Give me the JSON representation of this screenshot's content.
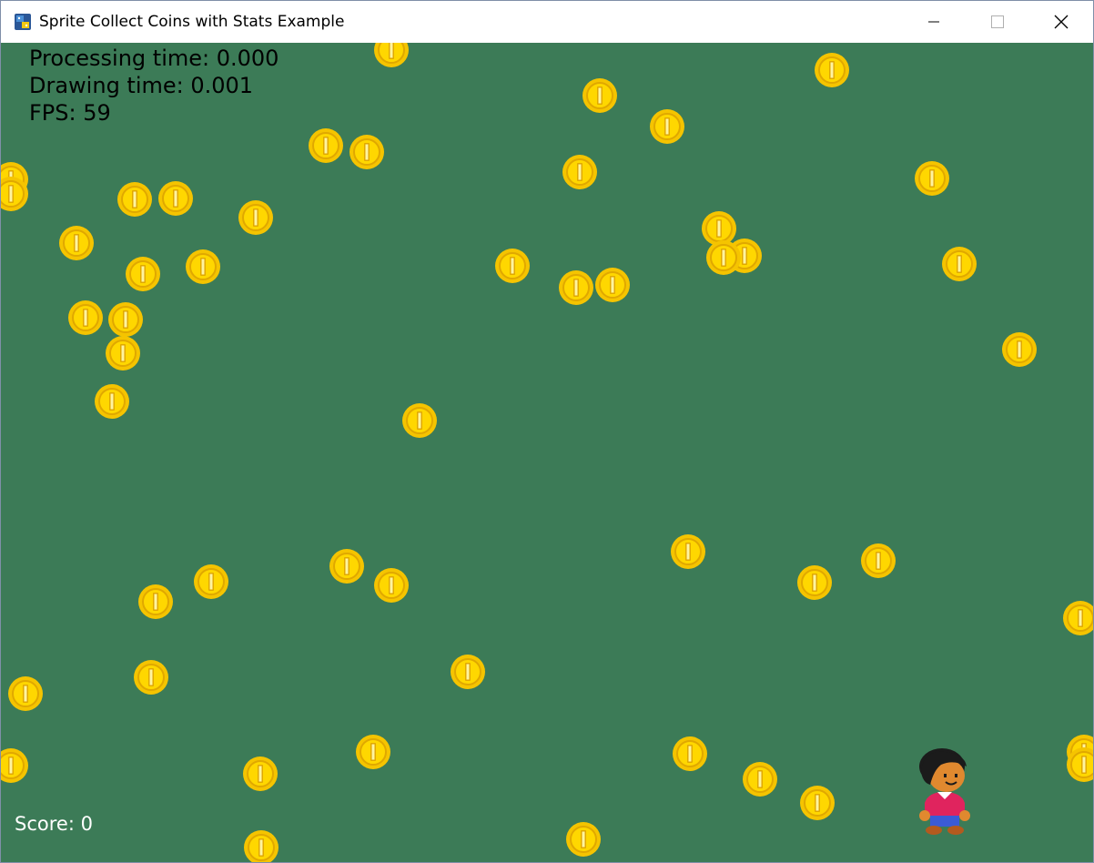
{
  "window": {
    "title": "Sprite Collect Coins with Stats Example",
    "minimize_label": "minimize",
    "maximize_label": "maximize",
    "close_label": "close"
  },
  "stats": {
    "processing_time": "Processing time: 0.000",
    "drawing_time": "Drawing time: 0.001",
    "fps": "FPS: 59"
  },
  "score": "Score: 0",
  "colors": {
    "background": "#3c7b57",
    "coin_outer": "#f5c400",
    "coin_inner": "#ffd700",
    "stats_text": "#000000",
    "score_text": "#ffffff"
  },
  "icons": [
    "python-app-icon",
    "minimize-icon",
    "maximize-icon",
    "close-icon",
    "coin-icon",
    "player-icon"
  ]
}
